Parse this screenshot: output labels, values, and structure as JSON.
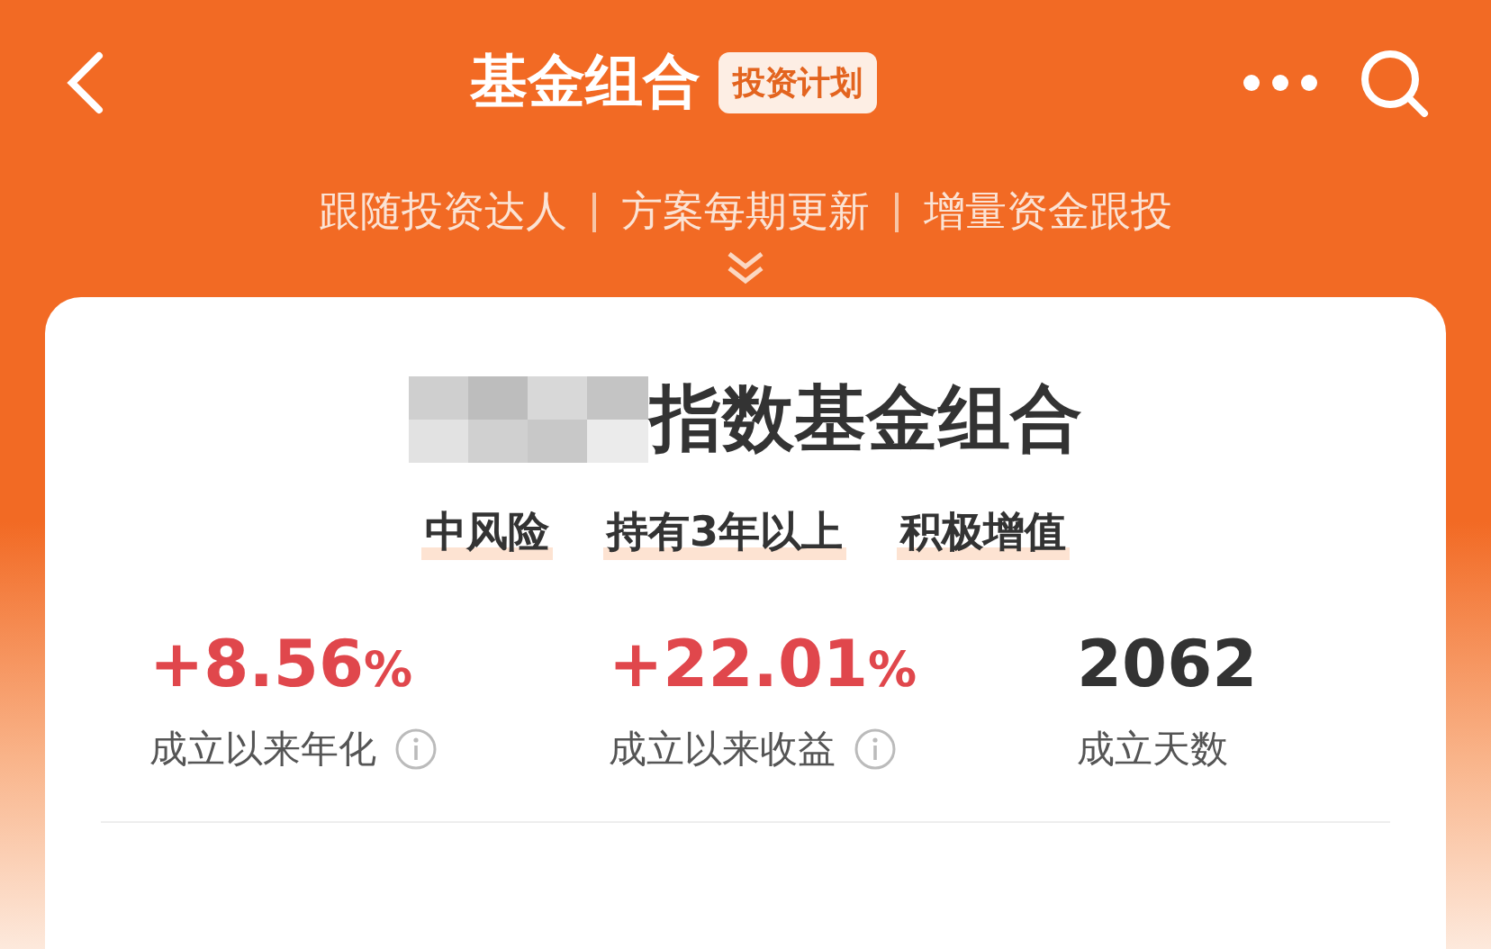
{
  "nav": {
    "title": "基金组合",
    "badge": "投资计划"
  },
  "taglines": [
    "跟随投资达人",
    "方案每期更新",
    "增量资金跟投"
  ],
  "card": {
    "title": "指数基金组合",
    "tags": [
      "中风险",
      "持有3年以上",
      "积极增值"
    ],
    "stats": [
      {
        "value": "+8.56",
        "unit": "%",
        "label": "成立以来年化",
        "info": true,
        "color": "#e0474c"
      },
      {
        "value": "+22.01",
        "unit": "%",
        "label": "成立以来收益",
        "info": true,
        "color": "#e0474c"
      },
      {
        "value": "2062",
        "label": "成立天数",
        "info": false,
        "color": "#333333"
      }
    ]
  }
}
